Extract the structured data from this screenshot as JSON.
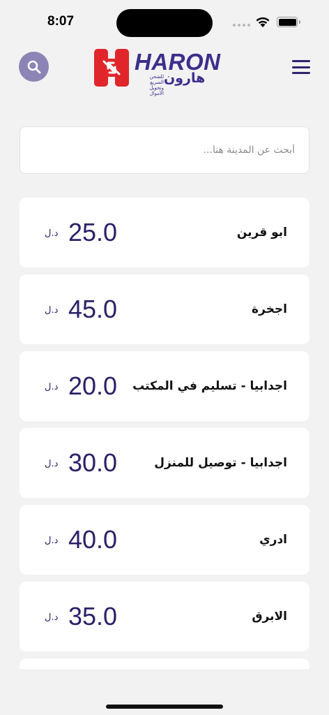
{
  "status_bar": {
    "time": "8:07"
  },
  "header": {
    "logo_text": "HARON",
    "logo_arabic": "هارون",
    "logo_tagline": "للشحن السريع وتحويل الأموال",
    "colors": {
      "brand": "#3d2d8c",
      "logo_red": "#e0262b",
      "search_button": "#8c84b5"
    }
  },
  "search": {
    "placeholder": "أبحث عن المدينة هنا...",
    "value": ""
  },
  "cities": [
    {
      "name": "ابو قرين",
      "price": "25.0",
      "currency": "د.ل"
    },
    {
      "name": "اجخرة",
      "price": "45.0",
      "currency": "د.ل"
    },
    {
      "name": "اجدابيا - تسليم في المكتب",
      "price": "20.0",
      "currency": "د.ل"
    },
    {
      "name": "اجدابيا - توصيل للمنزل",
      "price": "30.0",
      "currency": "د.ل"
    },
    {
      "name": "ادري",
      "price": "40.0",
      "currency": "د.ل"
    },
    {
      "name": "الابرق",
      "price": "35.0",
      "currency": "د.ل"
    }
  ]
}
